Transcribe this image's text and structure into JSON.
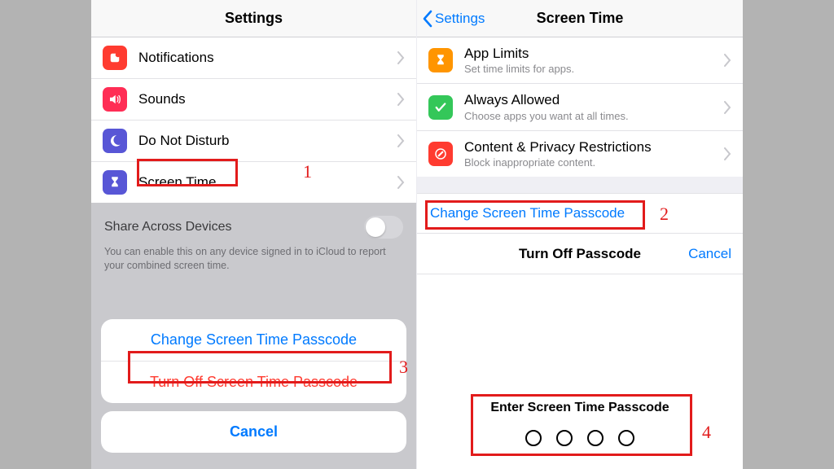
{
  "left": {
    "header_title": "Settings",
    "rows": [
      {
        "label": "Notifications"
      },
      {
        "label": "Sounds"
      },
      {
        "label": "Do Not Disturb"
      },
      {
        "label": "Screen Time"
      }
    ],
    "share": {
      "title": "Share Across Devices",
      "desc": "You can enable this on any device signed in to iCloud to report your combined screen time."
    },
    "sheet": {
      "change": "Change Screen Time Passcode",
      "turnoff": "Turn Off Screen Time Passcode",
      "cancel": "Cancel"
    }
  },
  "right": {
    "back_label": "Settings",
    "header_title": "Screen Time",
    "rows": [
      {
        "title": "App Limits",
        "sub": "Set time limits for apps."
      },
      {
        "title": "Always Allowed",
        "sub": "Choose apps you want at all times."
      },
      {
        "title": "Content & Privacy Restrictions",
        "sub": "Block inappropriate content."
      }
    ],
    "change_link": "Change Screen Time Passcode",
    "pass_header": "Turn Off Passcode",
    "cancel": "Cancel",
    "enter_label": "Enter Screen Time Passcode"
  },
  "steps": {
    "s1": "1",
    "s2": "2",
    "s3": "3",
    "s4": "4"
  },
  "colors": {
    "notifications": "#ff3b30",
    "sounds": "#ff2d55",
    "dnd": "#5856d6",
    "screentime": "#5856d6",
    "applimits": "#ff9500",
    "always": "#34c759",
    "restrict": "#ff3b30"
  }
}
